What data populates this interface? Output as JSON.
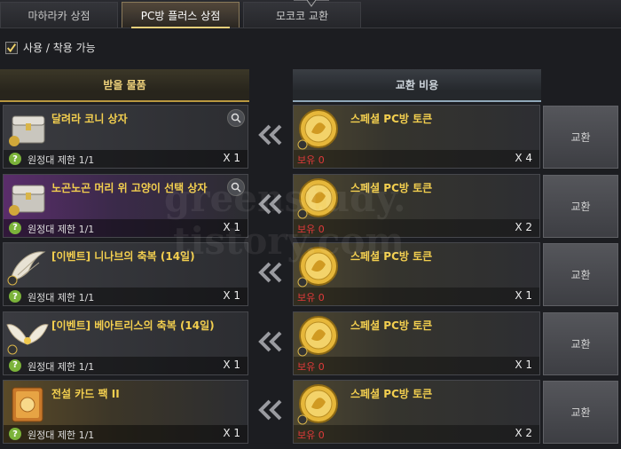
{
  "tabs": [
    {
      "label": "마하라카 상점",
      "active": false
    },
    {
      "label": "PC방 플러스 상점",
      "active": true
    },
    {
      "label": "모코코 교환",
      "active": false
    }
  ],
  "filter": {
    "label": "사용 / 착용 가능",
    "checked": true
  },
  "headers": {
    "receive": "받을 물품",
    "cost": "교환 비용"
  },
  "watermark": {
    "line1": "greenstudy.",
    "line2": "tistory.com"
  },
  "rows": [
    {
      "item_name": "달려라 코니 상자",
      "item_icon": "chest-icon",
      "tint": "plain",
      "has_search": true,
      "limit": "원정대 제한 1/1",
      "item_qty": "X 1",
      "cost_name": "스페셜 PC방 토큰",
      "owned": "보유 0",
      "cost_qty": "X 4",
      "button": "교환"
    },
    {
      "item_name": "노곤노곤 머리 위 고양이 선택 상자",
      "item_icon": "chest-icon",
      "tint": "purple",
      "has_search": true,
      "limit": "원정대 제한 1/1",
      "item_qty": "X 1",
      "cost_name": "스페셜 PC방 토큰",
      "owned": "보유 0",
      "cost_qty": "X 2",
      "button": "교환"
    },
    {
      "item_name": "[이벤트] 니나브의 축복 (14일)",
      "item_icon": "wing-icon",
      "tint": "plain",
      "has_search": false,
      "limit": "원정대 제한 1/1",
      "item_qty": "X 1",
      "cost_name": "스페셜 PC방 토큰",
      "owned": "보유 0",
      "cost_qty": "X 1",
      "button": "교환"
    },
    {
      "item_name": "[이벤트] 베아트리스의 축복 (14일)",
      "item_icon": "wings-icon",
      "tint": "plain",
      "has_search": false,
      "limit": "원정대 제한 1/1",
      "item_qty": "X 1",
      "cost_name": "스페셜 PC방 토큰",
      "owned": "보유 0",
      "cost_qty": "X 1",
      "button": "교환"
    },
    {
      "item_name": "전설 카드 팩 II",
      "item_icon": "card-pack-icon",
      "tint": "gold",
      "has_search": false,
      "limit": "원정대 제한 1/1",
      "item_qty": "X 1",
      "cost_name": "스페셜 PC방 토큰",
      "owned": "보유 0",
      "cost_qty": "X 2",
      "button": "교환"
    }
  ],
  "colors": {
    "item_name": "#f3cf4f",
    "owned_zero": "#e03a3a",
    "accent_gold": "#e8cf7a"
  }
}
